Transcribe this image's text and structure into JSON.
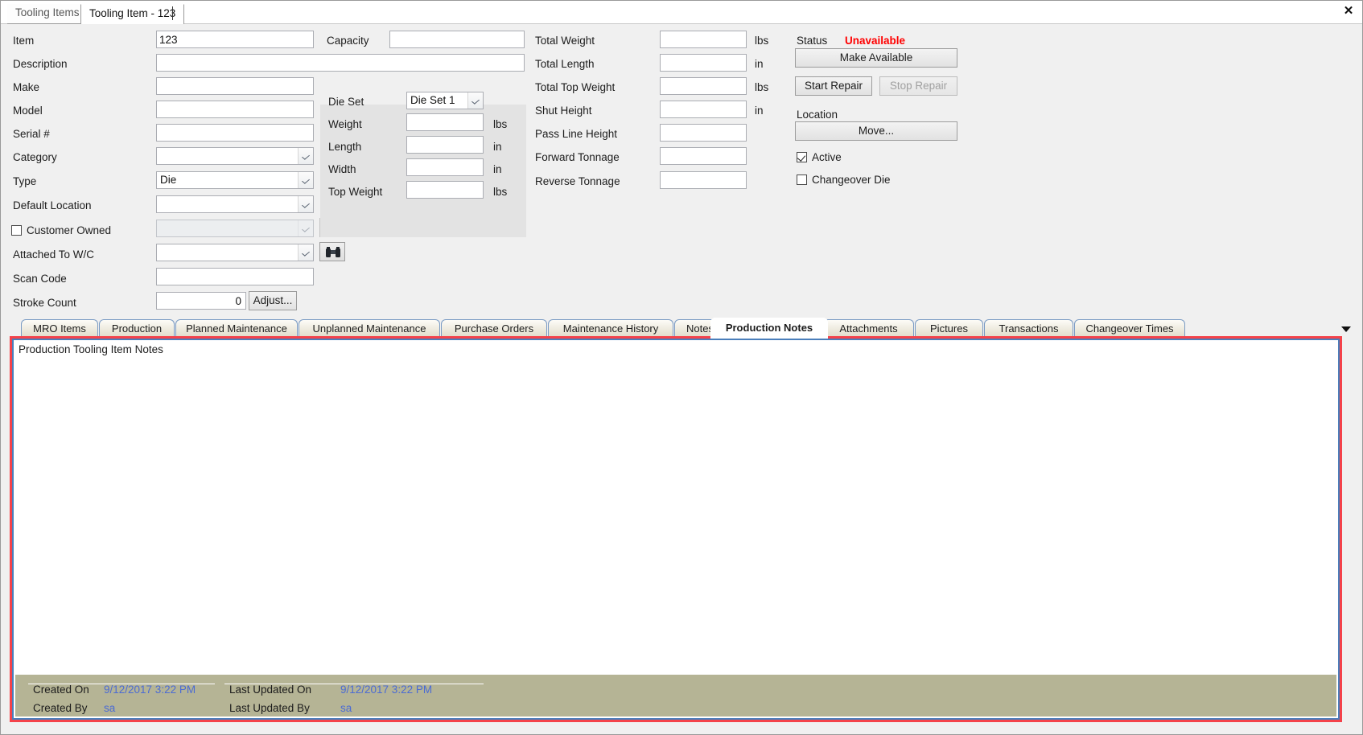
{
  "window": {
    "close_label": "✕"
  },
  "top_tabs": [
    {
      "label": "Tooling Items",
      "active": false
    },
    {
      "label": "Tooling Item - 123",
      "active": true
    }
  ],
  "form": {
    "left_column": [
      {
        "label": "Item",
        "value": "123",
        "control": "textbox"
      },
      {
        "label": "Description",
        "value": "",
        "control": "textbox"
      },
      {
        "label": "Make",
        "value": "",
        "control": "textbox"
      },
      {
        "label": "Model",
        "value": "",
        "control": "textbox"
      },
      {
        "label": "Serial #",
        "value": "",
        "control": "textbox"
      },
      {
        "label": "Category",
        "value": "",
        "control": "combobox"
      },
      {
        "label": "Type",
        "value": "Die",
        "control": "combobox"
      },
      {
        "label": "Default Location",
        "value": "",
        "control": "combobox"
      },
      {
        "label": "Customer Owned",
        "value": "",
        "control": "combobox-disabled",
        "checkbox": false
      },
      {
        "label": "Attached To W/C",
        "value": "",
        "control": "combobox"
      },
      {
        "label": "Scan Code",
        "value": "",
        "control": "textbox"
      },
      {
        "label": "Stroke Count",
        "value": "0",
        "control": "textbox-right"
      }
    ],
    "capacity": {
      "label": "Capacity",
      "value": ""
    },
    "adjust_button": "Adjust...",
    "die_set_panel": {
      "fields": [
        {
          "label": "Die Set",
          "value": "Die Set 1",
          "unit": "",
          "control": "combobox"
        },
        {
          "label": "Weight",
          "value": "",
          "unit": "lbs",
          "control": "textbox"
        },
        {
          "label": "Length",
          "value": "",
          "unit": "in",
          "control": "textbox"
        },
        {
          "label": "Width",
          "value": "",
          "unit": "in",
          "control": "textbox"
        },
        {
          "label": "Top Weight",
          "value": "",
          "unit": "lbs",
          "control": "textbox"
        }
      ]
    },
    "totals_column": [
      {
        "label": "Total Weight",
        "value": "",
        "unit": "lbs"
      },
      {
        "label": "Total Length",
        "value": "",
        "unit": "in"
      },
      {
        "label": "Total Top Weight",
        "value": "",
        "unit": "lbs"
      },
      {
        "label": "Shut Height",
        "value": "",
        "unit": "in"
      },
      {
        "label": "Pass Line Height",
        "value": "",
        "unit": ""
      },
      {
        "label": "Forward Tonnage",
        "value": "",
        "unit": ""
      },
      {
        "label": "Reverse Tonnage",
        "value": "",
        "unit": ""
      }
    ],
    "status_panel": {
      "status_label": "Status",
      "status_value": "Unavailable",
      "status_color": "#ff0000",
      "make_available_button": "Make Available",
      "start_repair_button": "Start Repair",
      "stop_repair_button": "Stop Repair",
      "location_label": "Location",
      "move_button": "Move...",
      "active_checkbox": {
        "label": "Active",
        "checked": true
      },
      "changeover_checkbox": {
        "label": "Changeover Die",
        "checked": false
      }
    }
  },
  "bottom_tabs": [
    {
      "label": "MRO Items",
      "active": false
    },
    {
      "label": "Production",
      "active": false
    },
    {
      "label": "Planned Maintenance",
      "active": false
    },
    {
      "label": "Unplanned Maintenance",
      "active": false
    },
    {
      "label": "Purchase Orders",
      "active": false
    },
    {
      "label": "Maintenance History",
      "active": false
    },
    {
      "label": "Notes",
      "active": false
    },
    {
      "label": "Production Notes",
      "active": true
    },
    {
      "label": "Attachments",
      "active": false
    },
    {
      "label": "Pictures",
      "active": false
    },
    {
      "label": "Transactions",
      "active": false
    },
    {
      "label": "Changeover Times",
      "active": false
    }
  ],
  "content": {
    "notes_header": "Production Tooling Item Notes",
    "notes_text": "",
    "meta": {
      "created_on_label": "Created On",
      "created_on_value": "9/12/2017 3:22 PM",
      "created_by_label": "Created By",
      "created_by_value": "sa",
      "last_updated_on_label": "Last Updated On",
      "last_updated_on_value": "9/12/2017 3:22 PM",
      "last_updated_by_label": "Last Updated By",
      "last_updated_by_value": "sa"
    }
  }
}
